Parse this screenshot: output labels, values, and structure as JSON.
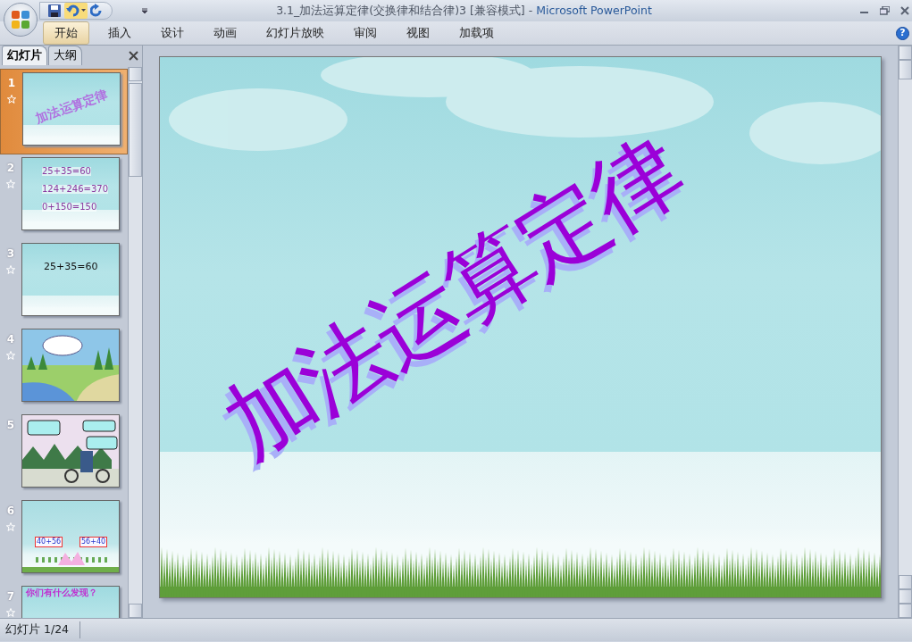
{
  "window": {
    "title_document": "3.1_加法运算定律(交换律和结合律)3 [兼容模式]",
    "title_separator": " - ",
    "title_app": "Microsoft PowerPoint"
  },
  "ribbon_tabs": [
    {
      "label": "开始",
      "selected": true
    },
    {
      "label": "插入",
      "selected": false
    },
    {
      "label": "设计",
      "selected": false
    },
    {
      "label": "动画",
      "selected": false
    },
    {
      "label": "幻灯片放映",
      "selected": false
    },
    {
      "label": "审阅",
      "selected": false
    },
    {
      "label": "视图",
      "selected": false
    },
    {
      "label": "加载项",
      "selected": false
    }
  ],
  "help": "?",
  "panel_tabs": [
    {
      "label": "幻灯片",
      "selected": true
    },
    {
      "label": "大纲",
      "selected": false
    }
  ],
  "slides": [
    {
      "number": "1",
      "animated": true,
      "selected": true,
      "kind": "title",
      "texts": [
        "加法运算定律"
      ]
    },
    {
      "number": "2",
      "animated": true,
      "selected": false,
      "kind": "equations",
      "texts": [
        "25+35=60",
        "124+246=370",
        "0+150=150"
      ]
    },
    {
      "number": "3",
      "animated": true,
      "selected": false,
      "kind": "equations",
      "texts": [
        "25+35=60"
      ]
    },
    {
      "number": "4",
      "animated": true,
      "selected": false,
      "kind": "scene"
    },
    {
      "number": "5",
      "animated": false,
      "selected": false,
      "kind": "road"
    },
    {
      "number": "6",
      "animated": true,
      "selected": false,
      "kind": "compare",
      "texts": [
        "40+56",
        "56+40"
      ]
    },
    {
      "number": "7",
      "animated": true,
      "selected": false,
      "kind": "heading",
      "texts": [
        "你们有什么发现？"
      ]
    }
  ],
  "current_slide": {
    "kind": "title",
    "title": "加法运算定律"
  },
  "status_bar": {
    "slide_counter": "幻灯片 1/24"
  }
}
